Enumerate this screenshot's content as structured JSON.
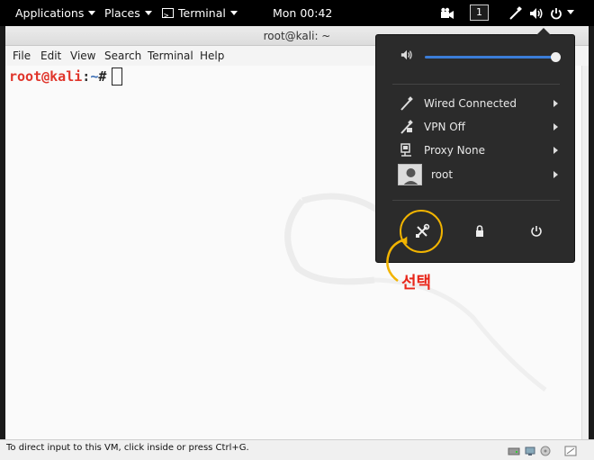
{
  "topbar": {
    "applications": "Applications",
    "places": "Places",
    "terminal": "Terminal",
    "clock": "Mon 00:42",
    "workspace": "1"
  },
  "window": {
    "title": "root@kali: ~",
    "menu": [
      "File",
      "Edit",
      "View",
      "Search",
      "Terminal",
      "Help"
    ]
  },
  "terminal": {
    "user_host": "root@kali",
    "colon": ":",
    "dir": "~",
    "hash": "#"
  },
  "popup": {
    "volume_level": 1.0,
    "rows": [
      {
        "label": "Wired Connected",
        "icon": "network-wired-icon"
      },
      {
        "label": "VPN Off",
        "icon": "vpn-icon"
      },
      {
        "label": "Proxy None",
        "icon": "proxy-icon"
      },
      {
        "label": "root",
        "icon": "user-avatar"
      }
    ],
    "buttons": [
      "settings-icon",
      "lock-icon",
      "power-icon"
    ]
  },
  "annotation": {
    "label": "선택",
    "circle_color": "#f2b400",
    "label_color": "#e8261a"
  },
  "status": {
    "text": "To direct input to this VM, click inside or press Ctrl+G."
  },
  "colors": {
    "accent": "#3b7dd8",
    "prompt_user": "#e0352b",
    "prompt_dir": "#3d6fb6"
  }
}
